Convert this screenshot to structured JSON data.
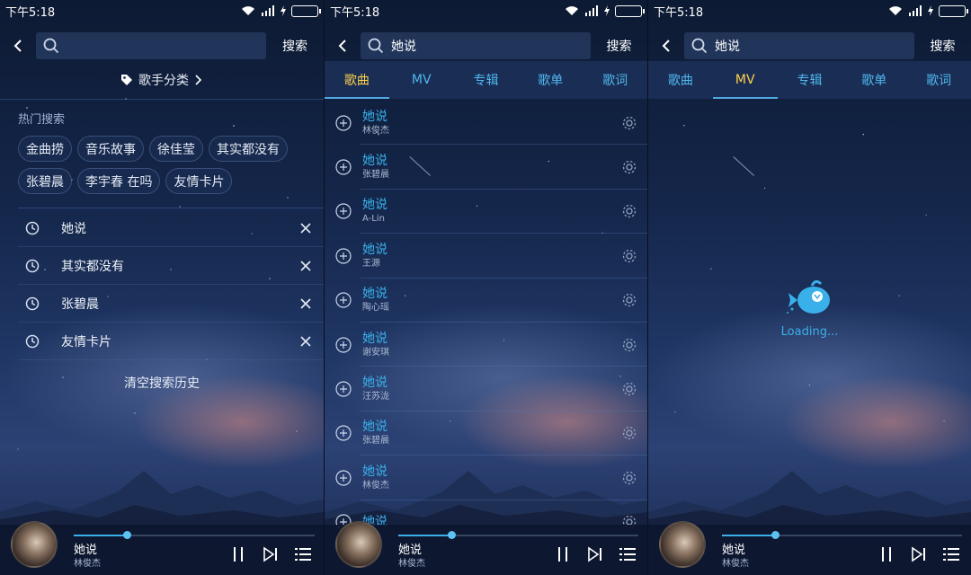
{
  "status_bar": {
    "time": "下午5:18"
  },
  "panels": {
    "search_home": {
      "search": {
        "value": "",
        "placeholder": "",
        "button": "搜索"
      },
      "singer_category": "歌手分类",
      "hot_title": "热门搜索",
      "hot_chips": [
        "金曲捞",
        "音乐故事",
        "徐佳莹",
        "其实都没有",
        "张碧晨",
        "李宇春 在吗",
        "友情卡片"
      ],
      "history": [
        "她说",
        "其实都没有",
        "张碧晨",
        "友情卡片"
      ],
      "clear_history": "清空搜索历史"
    },
    "results_songs": {
      "search": {
        "value": "她说",
        "button": "搜索"
      },
      "tabs": [
        "歌曲",
        "MV",
        "专辑",
        "歌单",
        "歌词"
      ],
      "active_tab": "歌曲",
      "songs": [
        {
          "title": "她说",
          "artist": "林俊杰"
        },
        {
          "title": "她说",
          "artist": "张碧晨"
        },
        {
          "title": "她说",
          "artist": "A-Lin"
        },
        {
          "title": "她说",
          "artist": "王源"
        },
        {
          "title": "她说",
          "artist": "陶心瑶"
        },
        {
          "title": "她说",
          "artist": "谢安琪"
        },
        {
          "title": "她说",
          "artist": "汪苏泷"
        },
        {
          "title": "她说",
          "artist": "张碧晨"
        },
        {
          "title": "她说",
          "artist": "林俊杰"
        },
        {
          "title": "她说",
          "artist": ""
        }
      ]
    },
    "results_mv": {
      "search": {
        "value": "她说",
        "button": "搜索"
      },
      "tabs": [
        "歌曲",
        "MV",
        "专辑",
        "歌单",
        "歌词"
      ],
      "active_tab": "MV",
      "loading_text": "Loading..."
    }
  },
  "player": {
    "title": "她说",
    "artist": "林俊杰",
    "progress_fraction": 0.22
  },
  "colors": {
    "accent_blue": "#3ab0ea",
    "active_tab_yellow": "#ffd24a",
    "battery_green": "#3adb4a"
  }
}
